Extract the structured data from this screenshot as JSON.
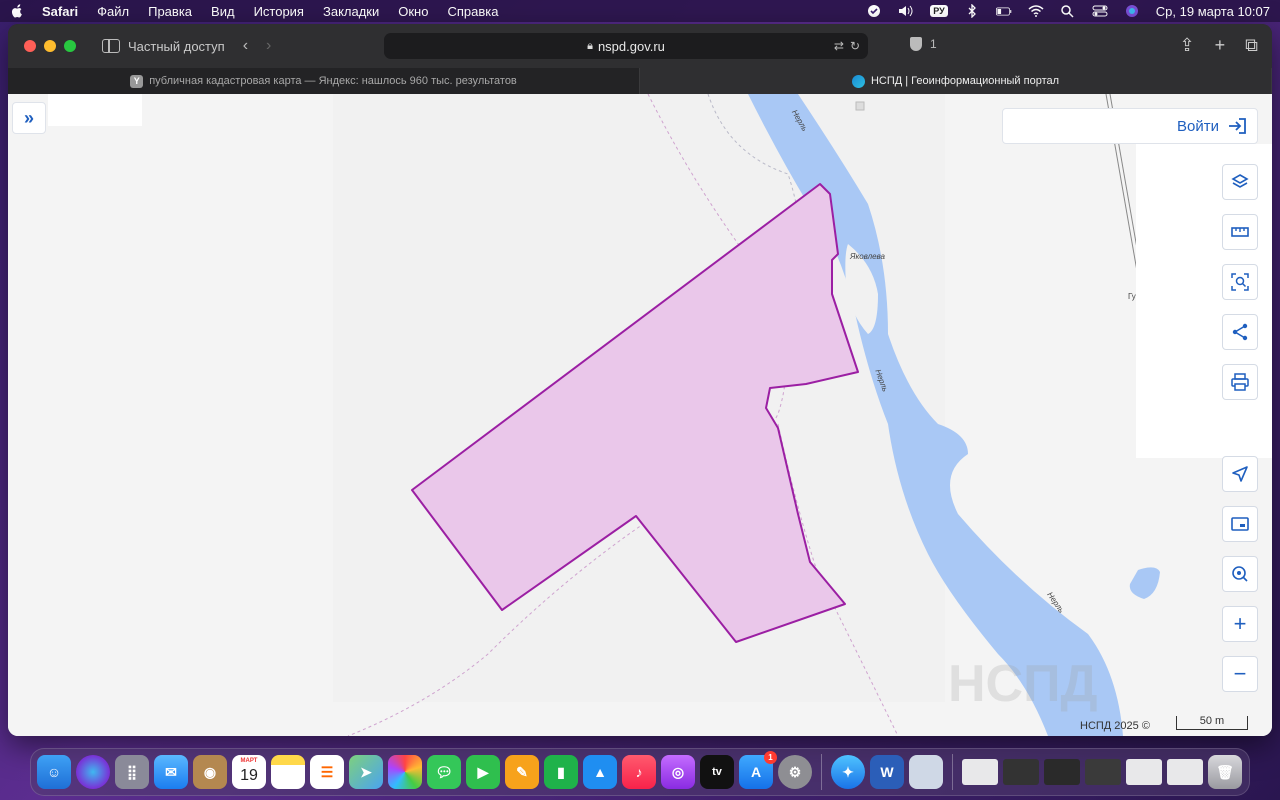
{
  "menubar": {
    "app": "Safari",
    "items": [
      "Файл",
      "Правка",
      "Вид",
      "История",
      "Закладки",
      "Окно",
      "Справка"
    ],
    "input_lang": "РУ",
    "datetime": "Ср, 19 марта  10:07"
  },
  "browser": {
    "private_label": "Частный доступ",
    "url": "nspd.gov.ru",
    "tracker_count": "1",
    "tabs": [
      {
        "favicon": "Y",
        "title": "публичная кадастровая карта — Яндекс: нашлось 960 тыс. результатов",
        "active": false
      },
      {
        "favicon": "",
        "title": "НСПД | Геоинформационный портал",
        "active": true
      }
    ]
  },
  "map": {
    "login_label": "Войти",
    "river_labels": [
      "Нерль",
      "Нерль",
      "Нерль"
    ],
    "place_label": "Яковлева",
    "edge_label": "Гу",
    "copyright": "НСПД 2025 ©",
    "scale_label": "50 m",
    "zoom_in": "+",
    "zoom_out": "−",
    "colors": {
      "water": "#a9c8f5",
      "parcel_fill": "#eac7ea",
      "parcel_stroke": "#9b1fa3",
      "accent": "#1f5fbf"
    }
  },
  "dock": {
    "calendar_month": "МАРТ",
    "calendar_day": "19",
    "appstore_badge": "1",
    "apps": [
      "Finder",
      "Siri",
      "Launchpad",
      "Mail",
      "Contacts",
      "Calendar",
      "Notes",
      "Reminders",
      "Maps",
      "Photos",
      "Messages",
      "FaceTime",
      "Pages",
      "Numbers",
      "Keynote",
      "Music",
      "Podcasts",
      "TV",
      "App Store",
      "System Settings",
      "Safari",
      "Word",
      "Preview"
    ]
  }
}
